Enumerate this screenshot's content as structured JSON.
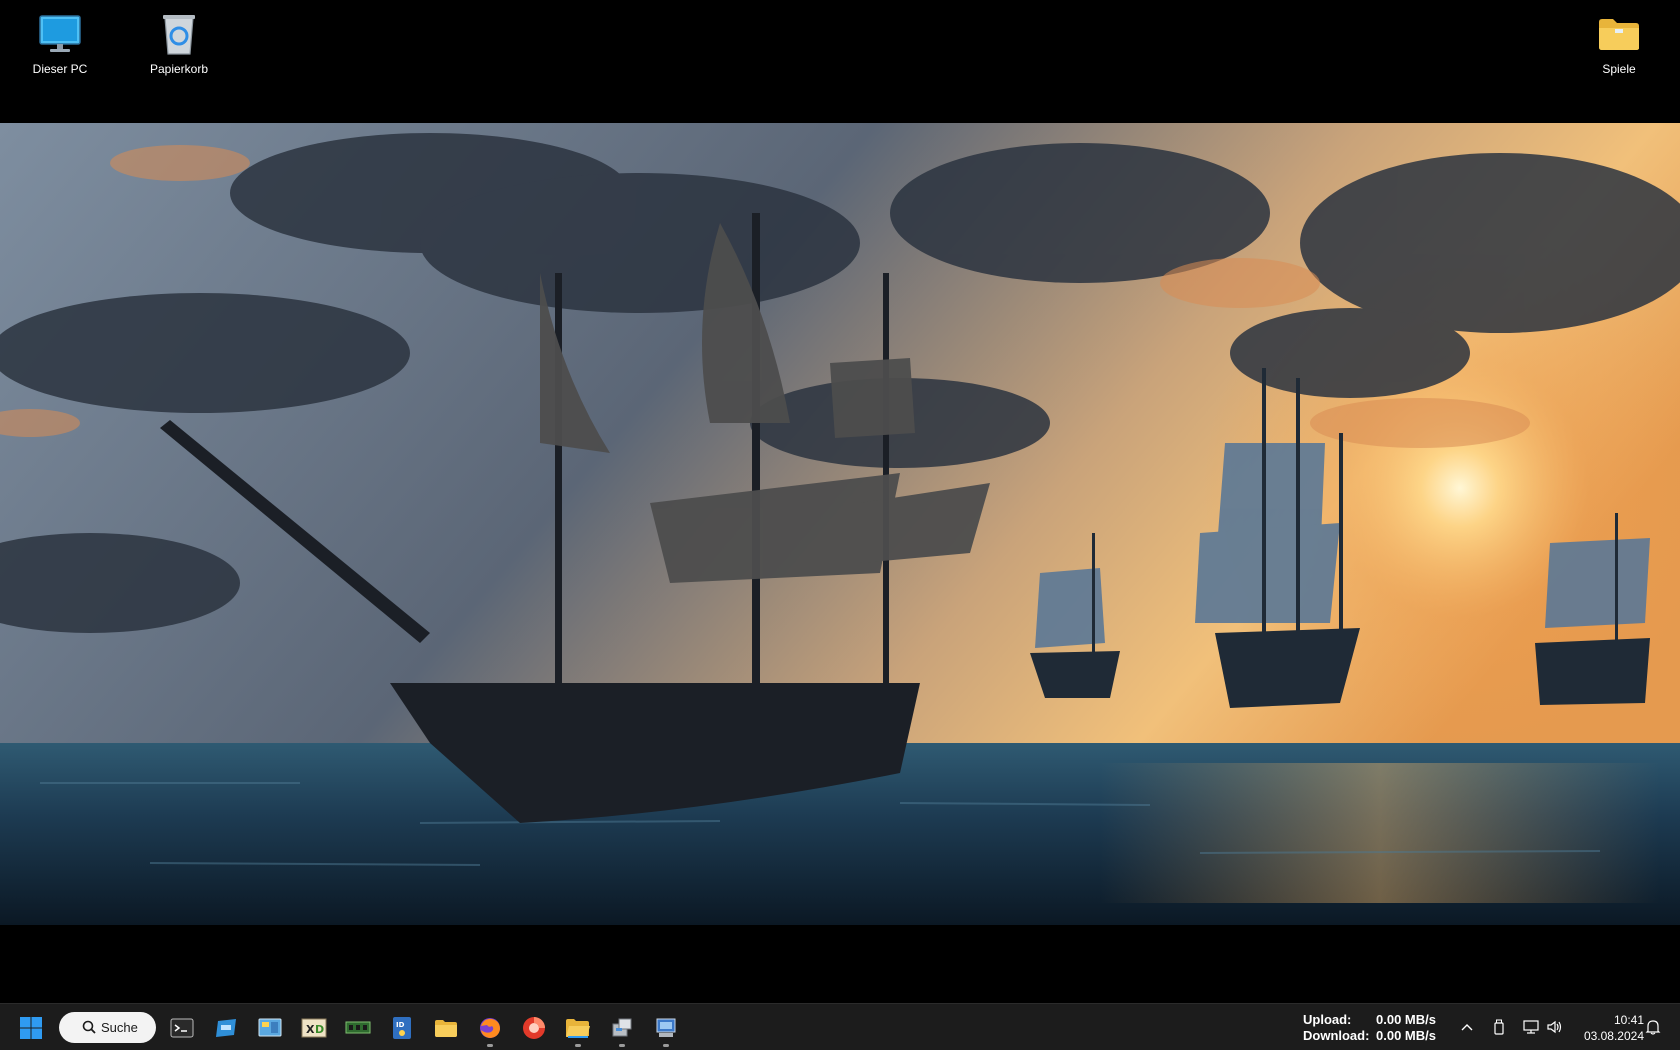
{
  "desktop": {
    "icons": [
      {
        "label": "Dieser PC",
        "icon": "this-pc-monitor-icon"
      },
      {
        "label": "Papierkorb",
        "icon": "recycle-bin-icon"
      },
      {
        "label": "Spiele",
        "icon": "folder-icon"
      }
    ],
    "wallpaper": "pirate-ships-at-sea-sunset"
  },
  "taskbar": {
    "search_label": "Suche",
    "pinned": [
      {
        "name": "terminal",
        "icon": "terminal-icon"
      },
      {
        "name": "app-blue",
        "icon": "app-window-icon"
      },
      {
        "name": "control-panel",
        "icon": "control-panel-icon"
      },
      {
        "name": "xd-app",
        "icon": "xd-app-icon"
      },
      {
        "name": "memory-tool",
        "icon": "memory-chip-icon"
      },
      {
        "name": "id-app",
        "icon": "id-card-icon"
      },
      {
        "name": "file-explorer",
        "icon": "folder-icon"
      },
      {
        "name": "firefox",
        "icon": "firefox-icon"
      },
      {
        "name": "media-app",
        "icon": "red-circle-app-icon"
      },
      {
        "name": "folder-open",
        "icon": "open-folder-icon"
      },
      {
        "name": "network-tool",
        "icon": "network-device-icon"
      },
      {
        "name": "system-tool",
        "icon": "computer-tool-icon"
      }
    ],
    "network": {
      "upload_label": "Upload:",
      "upload_value": "0.00 MB/s",
      "download_label": "Download:",
      "download_value": "0.00 MB/s"
    },
    "clock": {
      "time": "10:41",
      "date": "03.08.2024"
    },
    "colors": {
      "taskbar_bg": "#1c1c1c",
      "start_blue": "#2f9bf2"
    }
  }
}
